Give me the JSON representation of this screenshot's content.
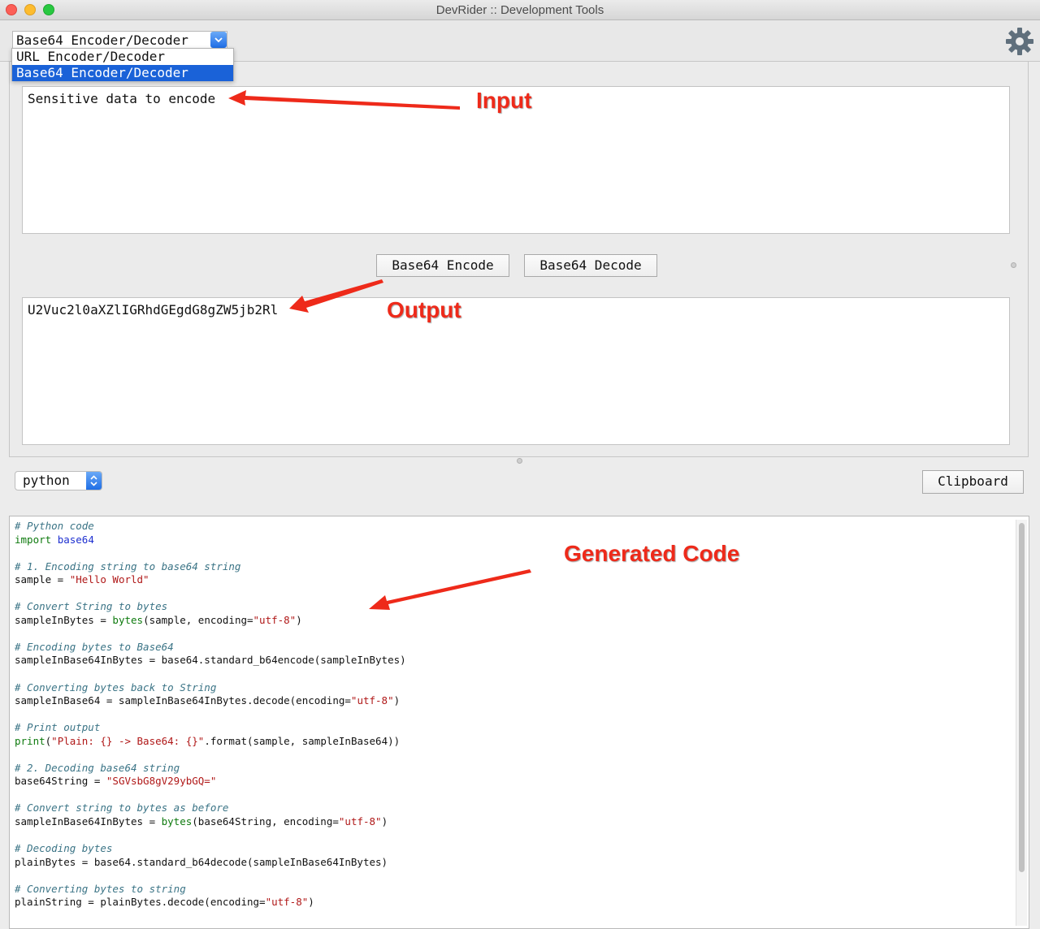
{
  "window": {
    "title": "DevRider :: Development Tools"
  },
  "tool_selector": {
    "selected": "Base64 Encoder/Decoder",
    "options": [
      "URL Encoder/Decoder",
      "Base64 Encoder/Decoder"
    ]
  },
  "input": {
    "value": "Sensitive data to encode"
  },
  "actions": {
    "encode_label": "Base64 Encode",
    "decode_label": "Base64 Decode"
  },
  "output": {
    "value": "U2Vuc2l0aXZlIGRhdGEgdG8gZW5jb2Rl"
  },
  "language_selector": {
    "selected": "python"
  },
  "clipboard_label": "Clipboard",
  "code_lines": [
    "# Python code",
    "import base64",
    "",
    "# 1. Encoding string to base64 string",
    "sample = \"Hello World\"",
    "",
    "# Convert String to bytes",
    "sampleInBytes = bytes(sample, encoding=\"utf-8\")",
    "",
    "# Encoding bytes to Base64",
    "sampleInBase64InBytes = base64.standard_b64encode(sampleInBytes)",
    "",
    "# Converting bytes back to String",
    "sampleInBase64 = sampleInBase64InBytes.decode(encoding=\"utf-8\")",
    "",
    "# Print output",
    "print(\"Plain: {} -> Base64: {}\".format(sample, sampleInBase64))",
    "",
    "# 2. Decoding base64 string",
    "base64String = \"SGVsbG8gV29ybGQ=\"",
    "",
    "# Convert string to bytes as before",
    "sampleInBase64InBytes = bytes(base64String, encoding=\"utf-8\")",
    "",
    "# Decoding bytes",
    "plainBytes = base64.standard_b64decode(sampleInBase64InBytes)",
    "",
    "# Converting bytes to string",
    "plainString = plainBytes.decode(encoding=\"utf-8\")"
  ],
  "annotations": {
    "input": "Input",
    "output": "Output",
    "code": "Generated Code"
  },
  "colors": {
    "annotation": "#ee2a1a",
    "selection": "#1a62d8",
    "comment": "#3b7486",
    "keyword": "#0e7a0e",
    "string": "#b01818"
  },
  "icons": {
    "settings": "gear-icon"
  }
}
